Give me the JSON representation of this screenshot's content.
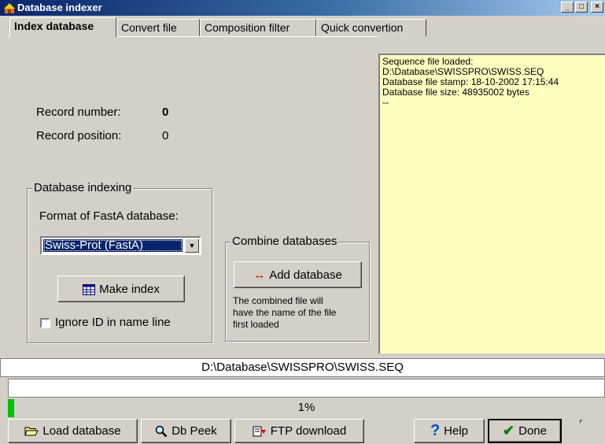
{
  "window": {
    "title": "Database indexer",
    "minimize": "_",
    "maximize": "□",
    "close": "×"
  },
  "tabs": [
    {
      "label": "Index database"
    },
    {
      "label": "Convert file"
    },
    {
      "label": "Composition filter"
    },
    {
      "label": "Quick convertion"
    }
  ],
  "record": {
    "number_label": "Record number:",
    "number_value": "0",
    "position_label": "Record position:",
    "position_value": "0"
  },
  "indexing": {
    "group_title": "Database indexing",
    "format_label": "Format of FastA database:",
    "format_selected": "Swiss-Prot (FastA)",
    "make_index_button": "Make index",
    "ignore_id_label": "Ignore ID in name line",
    "ignore_id_checked": false
  },
  "combine": {
    "group_title": "Combine databases",
    "add_button": "Add database",
    "note_line1": "The combined file will",
    "note_line2": "have the name of the file",
    "note_line3": "first loaded"
  },
  "log": {
    "lines": [
      "Sequence file loaded:",
      "D:\\Database\\SWISSPRO\\SWISS.SEQ",
      "Database file stamp: 18-10-2002 17:15:44",
      "Database file size: 48935002 bytes",
      "--"
    ]
  },
  "status": {
    "path": "D:\\Database\\SWISSPRO\\SWISS.SEQ",
    "progress_text": "1%",
    "progress_value": 0.01
  },
  "toolbar": {
    "load_database": "Load database",
    "db_peek": "Db Peek",
    "ftp_download": "FTP download",
    "help": "Help",
    "done": "Done"
  },
  "colors": {
    "log_background": "#ffffc0",
    "progress_fill": "#00c000",
    "title_bar": "#0a246a"
  }
}
